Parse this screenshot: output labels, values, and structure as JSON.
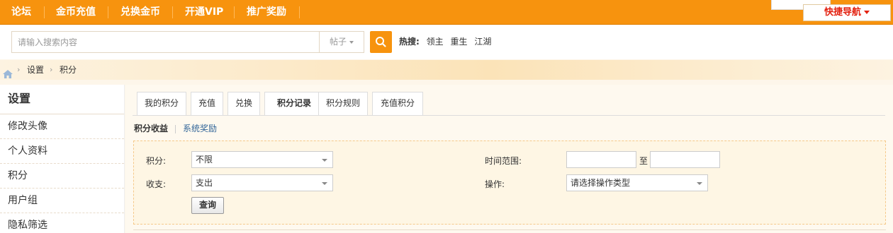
{
  "topnav": {
    "items": [
      "论坛",
      "金币充值",
      "兑换金币",
      "开通VIP",
      "推广奖励"
    ],
    "quick_nav_label": "快捷导航"
  },
  "search": {
    "placeholder": "请输入搜索内容",
    "type_label": "帖子",
    "hot_label": "热搜:",
    "hot_words": [
      "领主",
      "重生",
      "江湖"
    ]
  },
  "breadcrumb": {
    "items": [
      "设置",
      "积分"
    ],
    "separator": "›"
  },
  "sidebar": {
    "title": "设置",
    "items": [
      "修改头像",
      "个人资料",
      "积分",
      "用户组",
      "隐私筛选"
    ]
  },
  "tabs": [
    "我的积分",
    "充值",
    "兑换",
    "积分记录",
    "积分规则",
    "充值积分"
  ],
  "active_tab": "积分记录",
  "subnav": {
    "current": "积分收益",
    "link": "系统奖励"
  },
  "filter": {
    "credit_label": "积分:",
    "credit_value": "不限",
    "inout_label": "收支:",
    "inout_value": "支出",
    "time_label": "时间范围:",
    "time_sep": "至",
    "op_label": "操作:",
    "op_value": "请选择操作类型",
    "submit_label": "查询"
  },
  "colors": {
    "brand": "#f7930e",
    "link": "#336699",
    "quick_nav_text": "#e3200f"
  }
}
